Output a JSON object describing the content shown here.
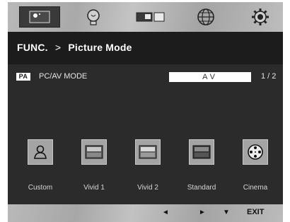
{
  "title": {
    "menu": "FUNC.",
    "separator": ">",
    "page": "Picture Mode"
  },
  "setting": {
    "badge": "PA",
    "label": "PC/AV MODE",
    "value": "AV",
    "page": "1 / 2"
  },
  "tabs": [
    {
      "icon": "picture-icon"
    },
    {
      "icon": "lightbulb-icon"
    },
    {
      "icon": "pip-icon"
    },
    {
      "icon": "globe-icon"
    },
    {
      "icon": "settings-gear-icon"
    }
  ],
  "modes": [
    {
      "label": "Custom",
      "icon": "person-icon"
    },
    {
      "label": "Vivid 1",
      "icon": "vivid1-icon"
    },
    {
      "label": "Vivid 2",
      "icon": "vivid2-icon"
    },
    {
      "label": "Standard",
      "icon": "standard-icon"
    },
    {
      "label": "Cinema",
      "icon": "film-reel-icon"
    }
  ],
  "footer": {
    "left": "◄",
    "right": "►",
    "down": "▼",
    "exit": "EXIT"
  }
}
